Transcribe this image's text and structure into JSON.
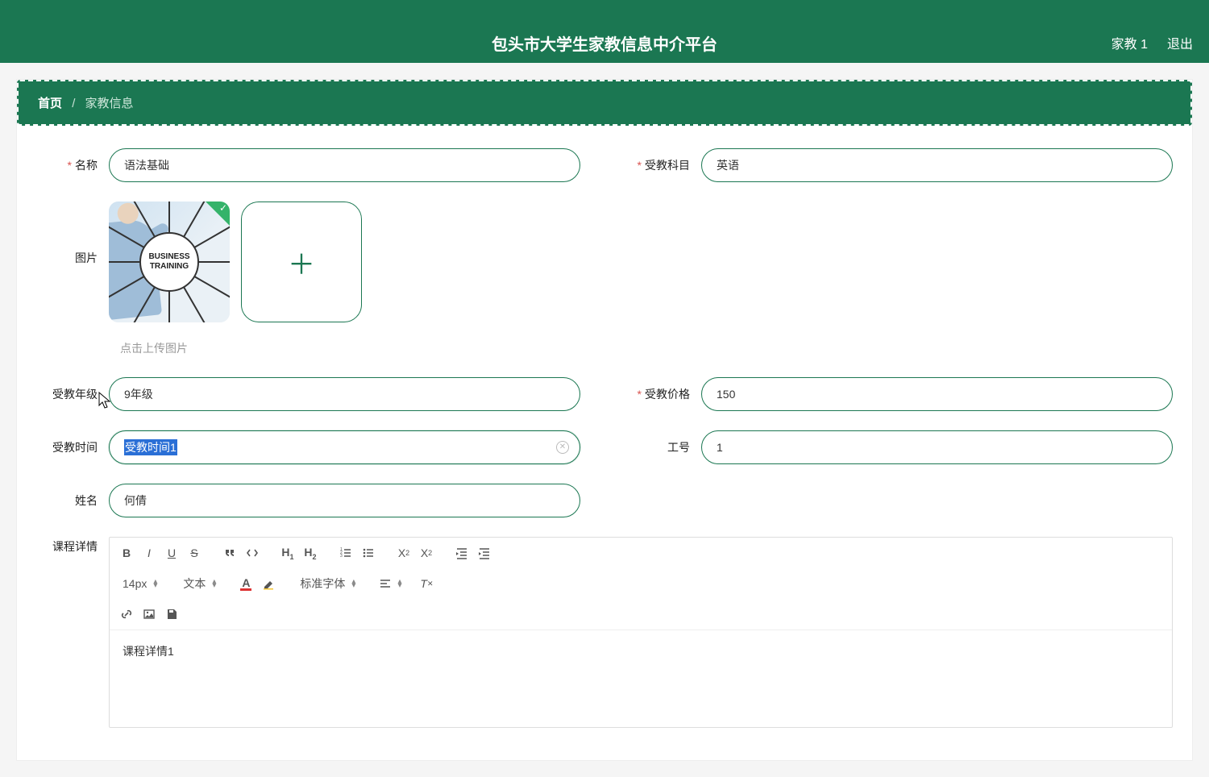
{
  "header": {
    "title": "包头市大学生家教信息中介平台",
    "user": "家教 1",
    "logout": "退出"
  },
  "breadcrumb": {
    "home": "首页",
    "current": "家教信息"
  },
  "form": {
    "name_label": "名称",
    "name_value": "语法基础",
    "subject_label": "受教科目",
    "subject_value": "英语",
    "image_label": "图片",
    "image_hint": "点击上传图片",
    "thumb_text1": "BUSINESS",
    "thumb_text2": "TRAINING",
    "grade_label": "受教年级",
    "grade_value": "9年级",
    "price_label": "受教价格",
    "price_value": "150",
    "time_label": "受教时间",
    "time_value": "受教时间1",
    "empno_label": "工号",
    "empno_value": "1",
    "teacher_label": "姓名",
    "teacher_value": "何倩",
    "detail_label": "课程详情",
    "detail_body": "课程详情1"
  },
  "editor_toolbar": {
    "font_size": "14px",
    "para": "文本",
    "font_family": "标准字体"
  }
}
